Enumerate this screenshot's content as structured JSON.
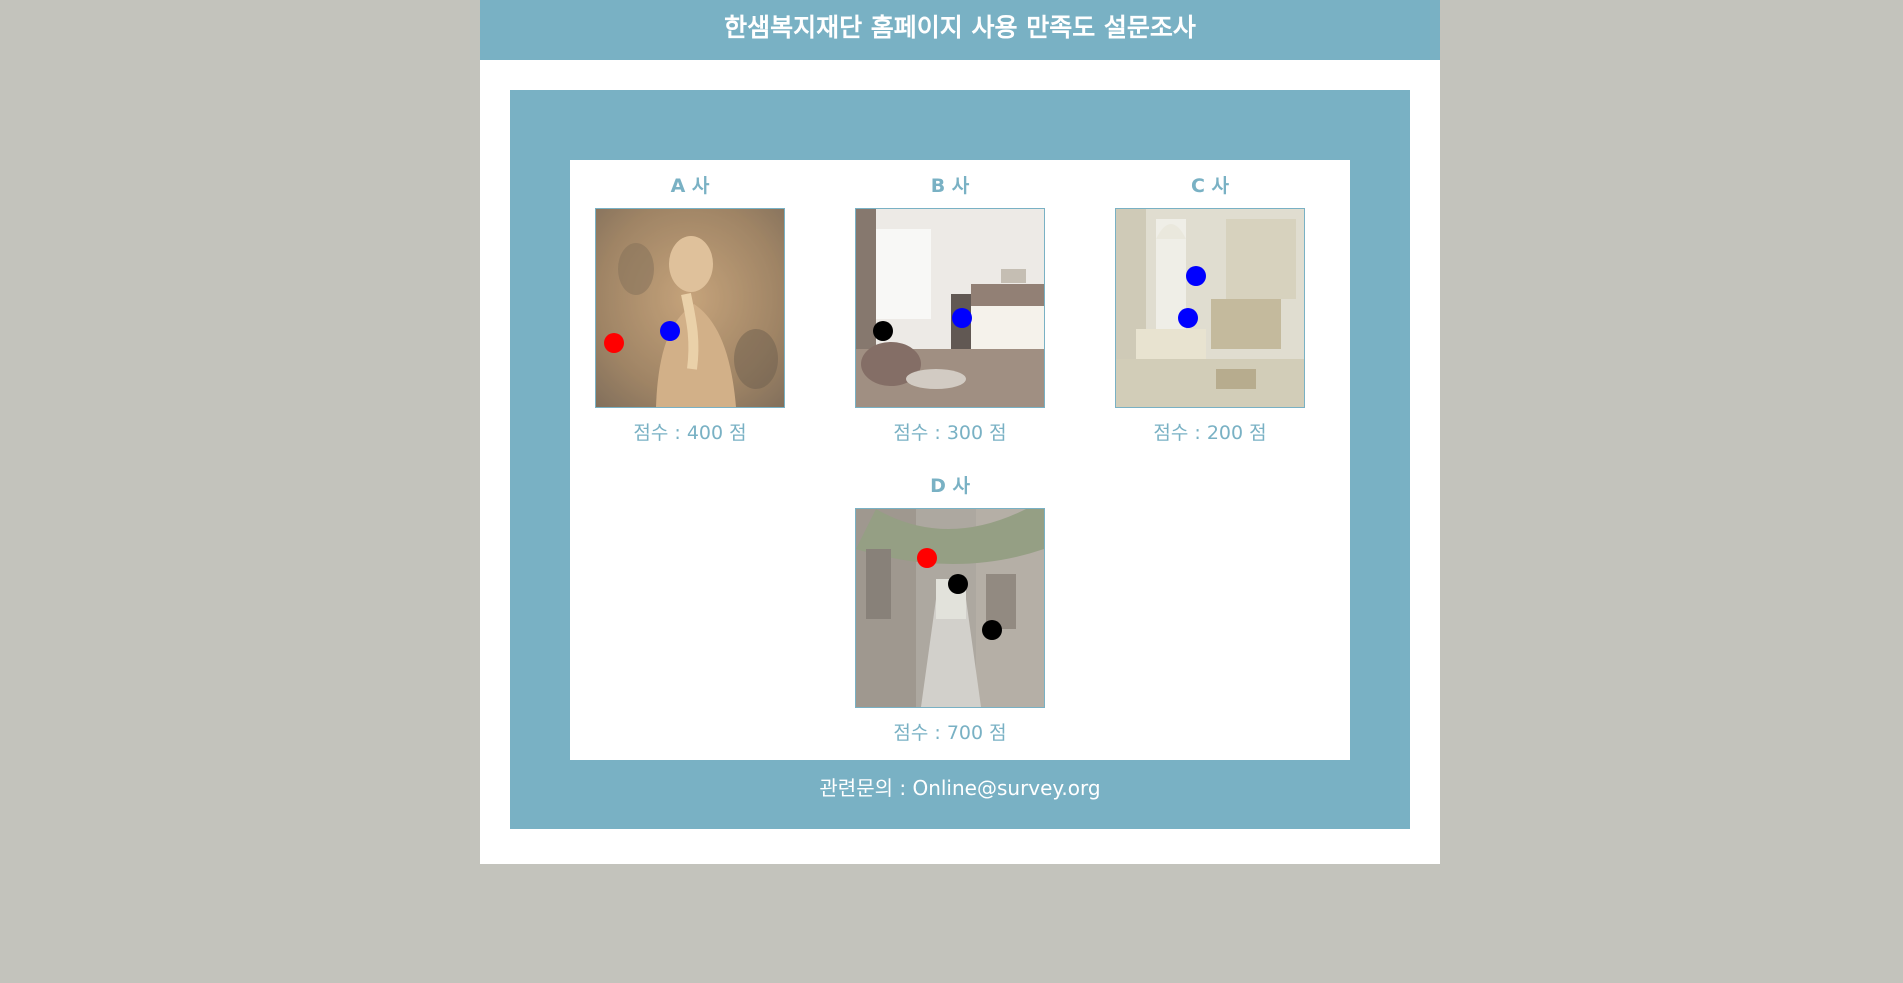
{
  "header": {
    "title": "한샘복지재단 홈페이지 사용 만족도 설문조사"
  },
  "companies": [
    {
      "name": "A 사",
      "score_text": "점수 : 400 점",
      "image": "sculpture-photo",
      "dots": [
        {
          "color": "#ff0000"
        },
        {
          "color": "#0000ff"
        }
      ]
    },
    {
      "name": "B 사",
      "score_text": "점수 : 300 점",
      "image": "hotel-room-photo",
      "dots": [
        {
          "color": "#000000"
        },
        {
          "color": "#0000ff"
        }
      ]
    },
    {
      "name": "C 사",
      "score_text": "점수 : 200 점",
      "image": "ornate-living-room-photo",
      "dots": [
        {
          "color": "#0000ff"
        },
        {
          "color": "#0000ff"
        }
      ]
    },
    {
      "name": "D 사",
      "score_text": "점수 : 700 점",
      "image": "stone-alley-photo",
      "dots": [
        {
          "color": "#ff0000"
        },
        {
          "color": "#000000"
        },
        {
          "color": "#000000"
        }
      ]
    }
  ],
  "footer": {
    "contact_text": "관련문의 : Online@survey.org"
  },
  "colors": {
    "accent": "#79b1c4",
    "background": "#c3c3bc"
  }
}
